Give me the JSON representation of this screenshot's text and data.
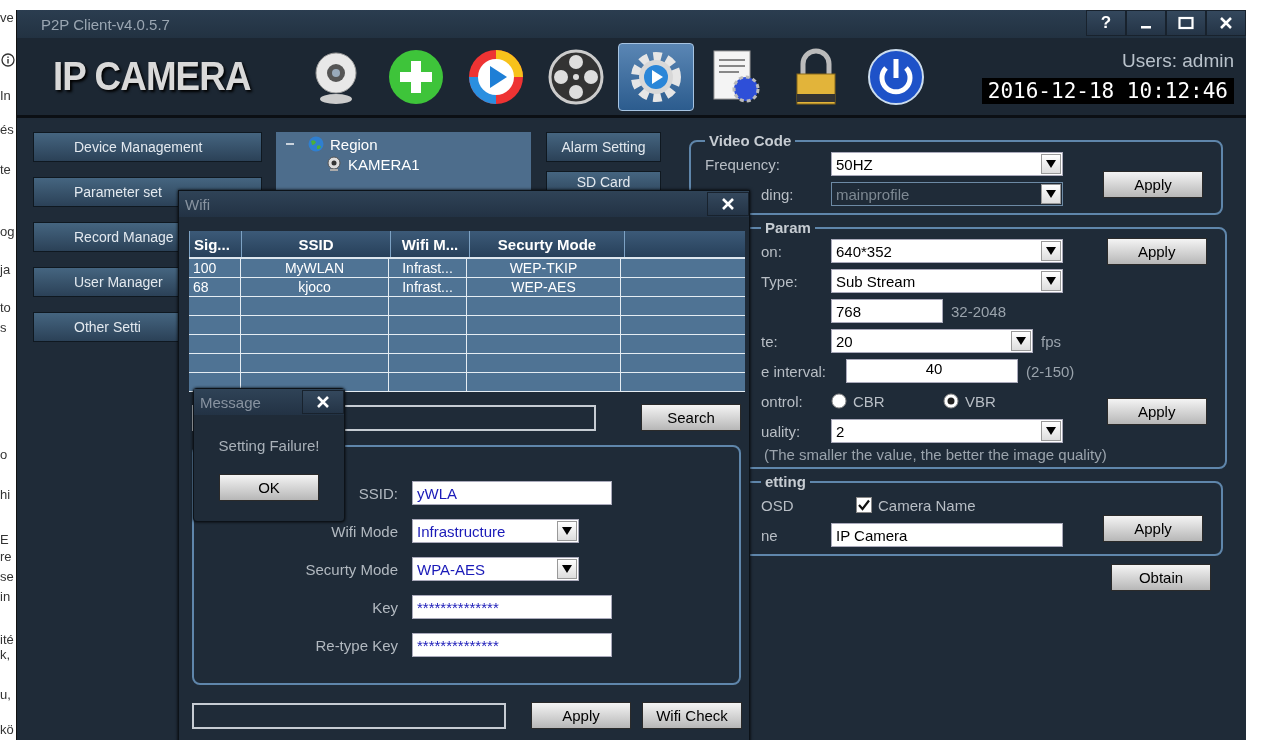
{
  "background_page": {
    "fragments": [
      "ve",
      "In",
      "és",
      "te",
      "og",
      "ja",
      "to",
      "s",
      "o",
      "hi",
      "E",
      "re",
      "se",
      "in",
      "ité",
      "k,",
      "u,",
      "kö"
    ]
  },
  "window": {
    "title": "P2P Client-v4.0.5.7",
    "help": "?"
  },
  "header": {
    "logo": "IP CAMERA",
    "toolbar": [
      {
        "kind": "webcam",
        "selected": false
      },
      {
        "kind": "add",
        "selected": false
      },
      {
        "kind": "play",
        "selected": false
      },
      {
        "kind": "reel",
        "selected": false
      },
      {
        "kind": "gear",
        "selected": true
      },
      {
        "kind": "document",
        "selected": false
      },
      {
        "kind": "lock",
        "selected": false
      },
      {
        "kind": "power",
        "selected": false
      }
    ],
    "user": "Users: admin",
    "datetime": "2016-12-18 10:12:46"
  },
  "sidebar": {
    "items": [
      "Device Management",
      "Parameter set",
      "Record Manage",
      "User Manager",
      "Other Setti"
    ]
  },
  "tree": {
    "root": {
      "label": "Region",
      "expanded": true,
      "children": [
        {
          "label": "KAMERA1"
        }
      ]
    }
  },
  "side_buttons": [
    "Alarm Setting",
    "SD Card"
  ],
  "video_code": {
    "title": "Video Code",
    "rows": [
      {
        "kind": "select",
        "label": "Frequency:",
        "value": "50HZ",
        "disabled": false
      },
      {
        "kind": "select",
        "label": "ding:",
        "value": "mainprofile",
        "disabled": true
      }
    ],
    "apply": "Apply"
  },
  "video_param": {
    "title": "Param",
    "rows": [
      {
        "kind": "select",
        "label": "on:",
        "value": "640*352",
        "disabled": false
      },
      {
        "kind": "select",
        "label": "Type:",
        "value": "Sub Stream",
        "disabled": false
      },
      {
        "kind": "input",
        "value": "768",
        "hint": "32-2048"
      },
      {
        "kind": "select",
        "label": "te:",
        "value": "20",
        "hint": "fps",
        "disabled": false
      },
      {
        "kind": "input",
        "label": "e interval:",
        "value": "40",
        "hint": "(2-150)"
      },
      {
        "kind": "radio",
        "label": "ontrol:",
        "options": [
          {
            "label": "CBR",
            "selected": false
          },
          {
            "label": "VBR",
            "selected": true
          }
        ]
      },
      {
        "kind": "select",
        "label": "uality:",
        "value": "2",
        "disabled": false
      }
    ],
    "note": "(The smaller the value, the better the image quality)",
    "apply_buttons": [
      "Apply",
      "Apply"
    ]
  },
  "osd": {
    "title": "etting",
    "rows": [
      {
        "kind": "check",
        "label": "OSD",
        "option": "Camera Name",
        "checked": true
      },
      {
        "kind": "input",
        "label": "ne",
        "value": "IP Camera"
      }
    ],
    "apply": "Apply"
  },
  "obtain": "Obtain",
  "wifi_dialog": {
    "title": "Wifi",
    "table": {
      "columns": [
        "Sig...",
        "SSID",
        "Wifi M...",
        "Securty Mode"
      ],
      "rows": [
        [
          "100",
          "MyWLAN",
          "Infrast...",
          "WEP-TKIP"
        ],
        [
          "68",
          "kjoco",
          "Infrast...",
          "WEP-AES"
        ]
      ]
    },
    "search_button": "Search",
    "form": [
      {
        "kind": "input",
        "label": "SSID:",
        "value": "yWLA"
      },
      {
        "kind": "select",
        "label": "Wifi Mode",
        "value": "Infrastructure"
      },
      {
        "kind": "select",
        "label": "Securty Mode",
        "value": "WPA-AES"
      },
      {
        "kind": "input",
        "label": "Key",
        "value": "**************"
      },
      {
        "kind": "input",
        "label": "Re-type Key",
        "value": "**************"
      }
    ],
    "buttons": [
      "Apply",
      "Wifi Check"
    ]
  },
  "message": {
    "title": "Message",
    "text": "Setting Failure!",
    "button": "OK"
  }
}
